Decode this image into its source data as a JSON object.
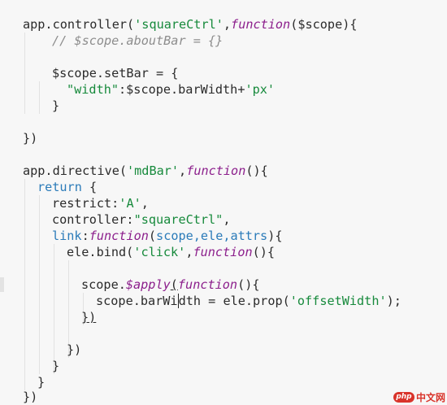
{
  "code": {
    "l1": {
      "a": "app.controller(",
      "b": "'squareCtrl'",
      "c": ",",
      "d": "function",
      "e": "($scope){"
    },
    "l2": {
      "a": "// $scope.aboutBar = {}"
    },
    "l3": {
      "a": "$scope.setBar = {"
    },
    "l4": {
      "a": "\"width\"",
      "b": ":$scope.barWidth+",
      "c": "'px'"
    },
    "l5": {
      "a": "}"
    },
    "l6": {
      "a": "})"
    },
    "l7": {
      "a": "app.directive(",
      "b": "'mdBar'",
      "c": ",",
      "d": "function",
      "e": "(){"
    },
    "l8": {
      "a": "return",
      "b": " {"
    },
    "l9": {
      "a": "restrict:",
      "b": "'A'",
      "c": ","
    },
    "l10": {
      "a": "controller:",
      "b": "\"squareCtrl\"",
      "c": ","
    },
    "l11": {
      "a": "link",
      "b": ":",
      "c": "function",
      "d": "(",
      "e": "scope,ele,attrs",
      "f": "){"
    },
    "l12": {
      "a": "ele.bind(",
      "b": "'click'",
      "c": ",",
      "d": "function",
      "e": "(){"
    },
    "l13": {
      "a": "scope.",
      "b": "$apply",
      "c": "(",
      "d": "function",
      "e": "(){"
    },
    "l14": {
      "a": "scope.barWi",
      "b": "dth = ele.prop(",
      "c": "'offsetWidth'",
      "d": ");"
    },
    "l15": {
      "a": "})",
      "b": ""
    },
    "l16": {
      "a": "})"
    },
    "l17": {
      "a": "}"
    },
    "l18": {
      "a": "}"
    },
    "l19": {
      "a": "})"
    }
  },
  "watermark": {
    "logo": "php",
    "text": "中文网"
  },
  "colors": {
    "string": "#178a3c",
    "keyword": "#8c1f8c",
    "return": "#2b7bb9",
    "comment": "#8d8d8d",
    "background": "#f7f7f7"
  }
}
